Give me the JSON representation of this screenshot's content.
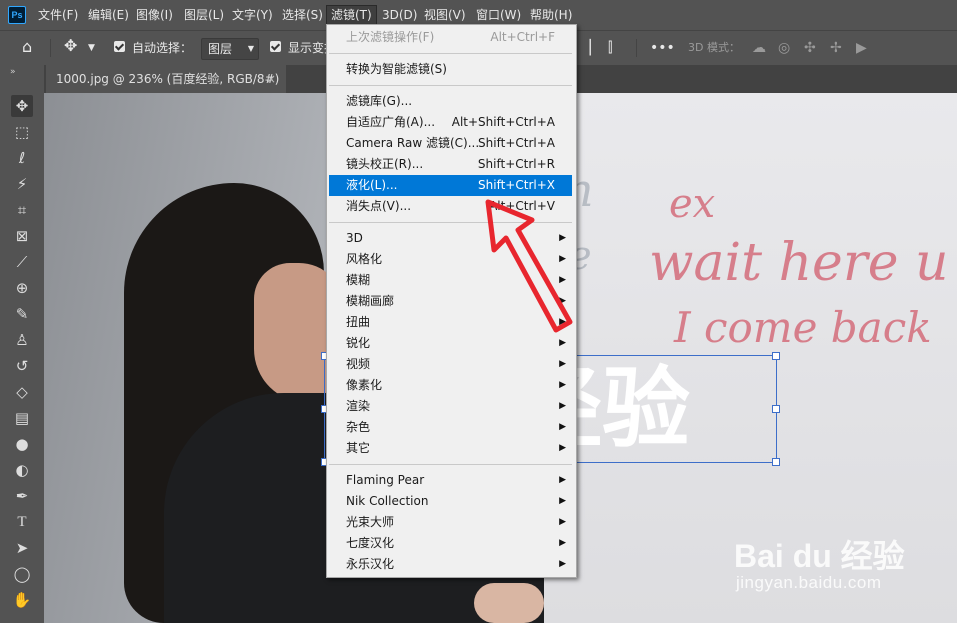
{
  "app": {
    "logo": "Ps"
  },
  "menubar": {
    "items": [
      "文件(F)",
      "编辑(E)",
      "图像(I)",
      "图层(L)",
      "文字(Y)",
      "选择(S)",
      "滤镜(T)",
      "3D(D)",
      "视图(V)",
      "窗口(W)",
      "帮助(H)"
    ],
    "active_index": 6
  },
  "options_bar": {
    "auto_select_label": "自动选择：",
    "auto_select_target": "图层",
    "show_transform_label": "显示变换控件",
    "mode_3d_label": "3D 模式："
  },
  "document_tab": {
    "title": "1000.jpg @ 236% (百度经验, RGB/8#) *",
    "close": "×"
  },
  "filter_menu": {
    "items": [
      {
        "label": "上次滤镜操作(F)",
        "shortcut": "Alt+Ctrl+F",
        "disabled": true
      },
      {
        "sep": true
      },
      {
        "label": "转换为智能滤镜(S)",
        "shortcut": ""
      },
      {
        "sep": true
      },
      {
        "label": "滤镜库(G)...",
        "shortcut": ""
      },
      {
        "label": "自适应广角(A)...",
        "shortcut": "Alt+Shift+Ctrl+A"
      },
      {
        "label": "Camera Raw 滤镜(C)...",
        "shortcut": "Shift+Ctrl+A"
      },
      {
        "label": "镜头校正(R)...",
        "shortcut": "Shift+Ctrl+R"
      },
      {
        "label": "液化(L)...",
        "shortcut": "Shift+Ctrl+X",
        "highlighted": true
      },
      {
        "label": "消失点(V)...",
        "shortcut": "Alt+Ctrl+V"
      },
      {
        "sep": true
      },
      {
        "label": "3D",
        "submenu": true
      },
      {
        "label": "风格化",
        "submenu": true
      },
      {
        "label": "模糊",
        "submenu": true
      },
      {
        "label": "模糊画廊",
        "submenu": true
      },
      {
        "label": "扭曲",
        "submenu": true
      },
      {
        "label": "锐化",
        "submenu": true
      },
      {
        "label": "视频",
        "submenu": true
      },
      {
        "label": "像素化",
        "submenu": true
      },
      {
        "label": "渲染",
        "submenu": true
      },
      {
        "label": "杂色",
        "submenu": true
      },
      {
        "label": "其它",
        "submenu": true
      },
      {
        "sep": true
      },
      {
        "label": "Flaming Pear",
        "submenu": true
      },
      {
        "label": "Nik Collection",
        "submenu": true
      },
      {
        "label": "光束大师",
        "submenu": true
      },
      {
        "label": "七度汉化",
        "submenu": true
      },
      {
        "label": "永乐汉化",
        "submenu": true
      }
    ]
  },
  "canvas": {
    "text_layer": "经验",
    "whiteboard_lines": [
      "ex",
      "wait here u",
      "I come back"
    ],
    "watermark_logo": "Bai du 经验",
    "watermark_url": "jingyan.baidu.com"
  },
  "colors": {
    "accent": "#0078d7",
    "annotation_arrow": "#e8262e",
    "handwriting": "#d46d7b"
  }
}
